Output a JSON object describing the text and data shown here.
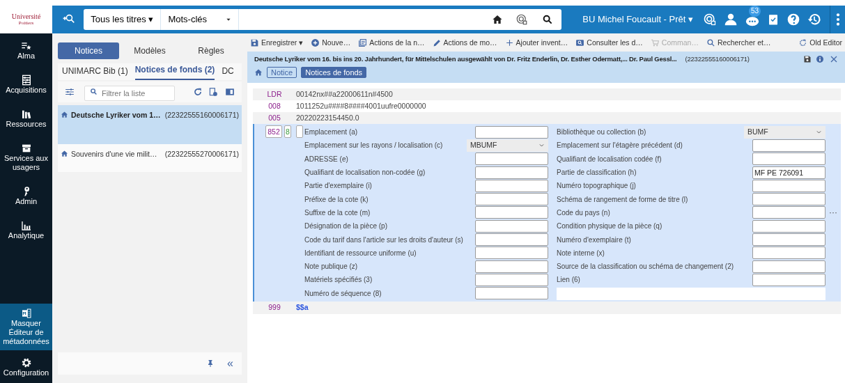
{
  "logo": {
    "line1": "Université",
    "line2": "Poitiers"
  },
  "search": {
    "scope": "Tous les titres ▾",
    "field": "Mots-clés"
  },
  "header": {
    "library": "BU Michel Foucault - Prêt ▾",
    "notifications": "53"
  },
  "nav": [
    {
      "label": "Alma",
      "selected": false
    },
    {
      "label": "Acquisitions",
      "selected": false
    },
    {
      "label": "Ressources",
      "selected": false
    },
    {
      "label": "Services aux usagers",
      "selected": false
    },
    {
      "label": "Admin",
      "selected": false
    },
    {
      "label": "Analytique",
      "selected": false
    }
  ],
  "nav_bottom": [
    {
      "label": "Masquer Éditeur de métadonnées",
      "selected": true
    },
    {
      "label": "Configuration",
      "selected": false
    }
  ],
  "left_tabs": [
    {
      "label": "Notices",
      "selected": true
    },
    {
      "label": "Modèles",
      "selected": false
    },
    {
      "label": "Règles",
      "selected": false
    }
  ],
  "sub_tabs": [
    {
      "label": "UNIMARC Bib (1)",
      "selected": false
    },
    {
      "label": "Notices de fonds (2)",
      "selected": true
    },
    {
      "label": "DC",
      "selected": false
    }
  ],
  "filter": {
    "placeholder": "Filtrer la liste"
  },
  "records": [
    {
      "title": "Deutsche Lyriker vom 1…",
      "id": "(22322555160006171)",
      "selected": true
    },
    {
      "title": "Souvenirs d'une vie milit…",
      "id": "(22322555270006171)",
      "selected": false
    }
  ],
  "toolbar": [
    {
      "label": "Enregistrer ▾",
      "disabled": false
    },
    {
      "label": "Nouve…",
      "disabled": false
    },
    {
      "label": "Actions de la n…",
      "disabled": false
    },
    {
      "label": "Actions de mo…",
      "disabled": false
    },
    {
      "label": "Ajouter invent…",
      "disabled": false
    },
    {
      "label": "Consulter les d…",
      "disabled": false
    },
    {
      "label": "Comman…",
      "disabled": true
    },
    {
      "label": "Rechercher et…",
      "disabled": false
    },
    {
      "label": "Old Editor",
      "disabled": false
    }
  ],
  "record": {
    "title": "Deutsche Lyriker vom 16. bis ins 20. Jahrhundert, für Mittelschulen ausgewählt von Dr. Fritz Enderlin, Dr. Esther Odermatt,... Dr. Paul Gessl...",
    "id": "(22322555160006171)",
    "crumbs": [
      "Notice",
      "Notices de fonds"
    ]
  },
  "control_fields": [
    {
      "tag": "LDR",
      "value": "00142nx##a22000611n#4500"
    },
    {
      "tag": "008",
      "value": "1011252u####8####4001uufre0000000"
    },
    {
      "tag": "005",
      "value": "20220223154450.0"
    }
  ],
  "field_852": {
    "tag": "852",
    "ind1": "8",
    "left": [
      {
        "label": "Emplacement (a)",
        "kind": "text"
      },
      {
        "label": "Emplacement sur les rayons / localisation (c)",
        "kind": "select",
        "value": "MBUMF"
      },
      {
        "label": "ADRESSE (e)",
        "kind": "text"
      },
      {
        "label": "Qualifiant de localisation non-codée (g)",
        "kind": "text"
      },
      {
        "label": "Partie d'exemplaire (i)",
        "kind": "text"
      },
      {
        "label": "Préfixe de la cote (k)",
        "kind": "text"
      },
      {
        "label": "Suffixe de la cote (m)",
        "kind": "text"
      },
      {
        "label": "Désignation de la pièce (p)",
        "kind": "text"
      },
      {
        "label": "Code du tarif dans l'article sur les droits d'auteur (s)",
        "kind": "text"
      },
      {
        "label": "Identifiant de ressource uniforme (u)",
        "kind": "text"
      },
      {
        "label": "Note publique (z)",
        "kind": "text"
      },
      {
        "label": "Matériels spécifiés (3)",
        "kind": "text"
      },
      {
        "label": "Numéro de séquence (8)",
        "kind": "text"
      }
    ],
    "right": [
      {
        "label": "Bibliothèque ou collection (b)",
        "kind": "select",
        "value": "BUMF"
      },
      {
        "label": "Emplacement sur l'étagère précédent (d)",
        "kind": "text"
      },
      {
        "label": "Qualifiant de localisation codée (f)",
        "kind": "text"
      },
      {
        "label": "Partie de classification (h)",
        "kind": "text",
        "value": "MF PE 726091"
      },
      {
        "label": "Numéro topographique (j)",
        "kind": "text"
      },
      {
        "label": "Schéma de rangement de forme de titre (l)",
        "kind": "text"
      },
      {
        "label": "Code du pays (n)",
        "kind": "text"
      },
      {
        "label": "Condition physique de la pièce (q)",
        "kind": "text"
      },
      {
        "label": "Numéro d'exemplaire (t)",
        "kind": "text"
      },
      {
        "label": "Note interne (x)",
        "kind": "text"
      },
      {
        "label": "Source de la classification ou schéma de changement (2)",
        "kind": "text"
      },
      {
        "label": "Lien (6)",
        "kind": "text"
      },
      {
        "kind": "blank"
      }
    ],
    "more": "···"
  },
  "field_999": {
    "tag": "999",
    "value": "$$a"
  },
  "panel_footer": {
    "collapse": "«"
  }
}
